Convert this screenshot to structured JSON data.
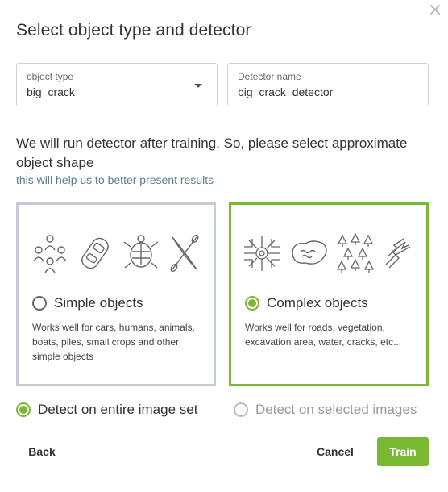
{
  "dialog": {
    "title": "Select object type and detector",
    "close_icon": "close-icon"
  },
  "fields": {
    "object_type": {
      "label": "object type",
      "value": "big_crack"
    },
    "detector_name": {
      "label": "Detector name",
      "value": "big_crack_detector"
    }
  },
  "intro": {
    "text": "We will run detector after training. So, please select approximate object shape",
    "subtext": "this will help us to better present results"
  },
  "cards": {
    "simple": {
      "label": "Simple objects",
      "description": "Works well for cars, humans, animals, boats, piles, small crops and other simple objects",
      "selected": false,
      "icons": [
        "people-group-icon",
        "car-icon",
        "turtle-icon",
        "kayak-icon"
      ]
    },
    "complex": {
      "label": "Complex objects",
      "description": "Works well for roads, vegetation, excavation area, water, cracks, etc...",
      "selected": true,
      "icons": [
        "road-network-icon",
        "water-pond-icon",
        "trees-icon",
        "crack-icon"
      ]
    }
  },
  "scope": {
    "entire": {
      "label": "Detect on entire image set",
      "selected": true
    },
    "selected": {
      "label": "Detect on selected images",
      "selected": false
    }
  },
  "buttons": {
    "back": "Back",
    "cancel": "Cancel",
    "train": "Train"
  },
  "colors": {
    "accent": "#78b833",
    "card_border_inactive": "#c3ccd4",
    "subtext": "#5a7f8f"
  }
}
